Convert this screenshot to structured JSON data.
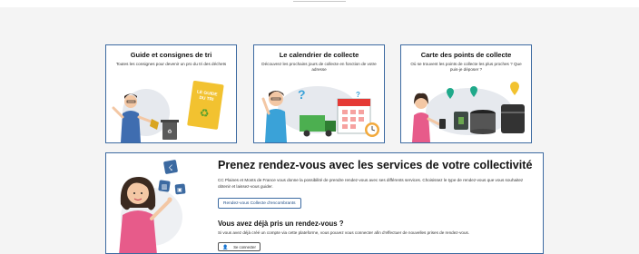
{
  "cards": [
    {
      "title": "Guide et consignes de tri",
      "desc": "Toutes les consignes pour devenir un pro du tri des déchets",
      "book_title": "LE GUIDE DU TRI"
    },
    {
      "title": "Le calendrier de collecte",
      "desc": "Découvrez les prochains jours de collecte en fonction de votre adresse"
    },
    {
      "title": "Carte des points de collecte",
      "desc": "Où se trouvent les points de collecte les plus proches ? Que puis-je déposer ?"
    }
  ],
  "rdv": {
    "title": "Prenez rendez-vous avec les services de votre collectivité",
    "desc": "CC Plaines et Monts de France vous donne la possibilité de prendre rendez-vous avec ses différents services. Choisissez le type de rendez-vous que vous souhaitez obtenir et laissez-vous guider.",
    "button_label": "Rendez-vous Collecte d'encombrants",
    "sub_title": "Vous avez déjà pris un rendez-vous ?",
    "sub_desc": "Si vous avez déjà créé un compte via cette plateforme, vous pouvez vous connecter afin d'effectuer de nouvelles prises de rendez-vous.",
    "connect_label": "Se connecter"
  },
  "colors": {
    "accent": "#3c6aa1",
    "green": "#4caf50",
    "yellow": "#f2c230",
    "skin": "#f3c7a4",
    "hair": "#3b2a20"
  },
  "icons": [
    "recycle-icon",
    "calendar-icon",
    "map-pin-icon",
    "user-icon",
    "bin-icon",
    "truck-icon",
    "clock-icon",
    "pointing-hand-icon"
  ]
}
